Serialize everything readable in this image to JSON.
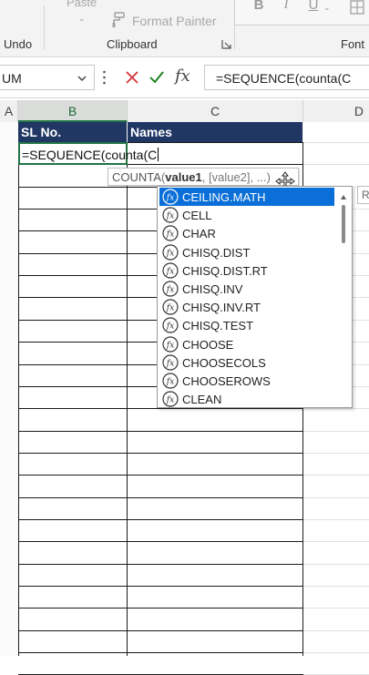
{
  "ribbon": {
    "paste_label": "Paste",
    "format_painter_label": "Format Painter",
    "groups": {
      "undo": "Undo",
      "clipboard": "Clipboard",
      "font": "Font"
    },
    "font_buttons": {
      "bold": "B",
      "italic": "I",
      "underline": "U"
    }
  },
  "formula_bar": {
    "name_box_value": "UM",
    "fx_label": "fx",
    "formula": "=SEQUENCE(counta(C"
  },
  "columns": [
    "A",
    "B",
    "C",
    "D"
  ],
  "sheet": {
    "header_row": {
      "b": "SL No.",
      "c": "Names"
    },
    "active_cell_text": "=SEQUENCE(counta(C"
  },
  "tooltip": {
    "function": "COUNTA",
    "arg_bold": "value1",
    "rest": ", [value2], ...)",
    "side_letter": "R"
  },
  "autocomplete": {
    "selected_index": 0,
    "items": [
      "CEILING.MATH",
      "CELL",
      "CHAR",
      "CHISQ.DIST",
      "CHISQ.DIST.RT",
      "CHISQ.INV",
      "CHISQ.INV.RT",
      "CHISQ.TEST",
      "CHOOSE",
      "CHOOSECOLS",
      "CHOOSEROWS",
      "CLEAN"
    ]
  },
  "colors": {
    "header_fill": "#203764",
    "excel_green": "#217346",
    "selection_blue": "#0a6fd8"
  }
}
